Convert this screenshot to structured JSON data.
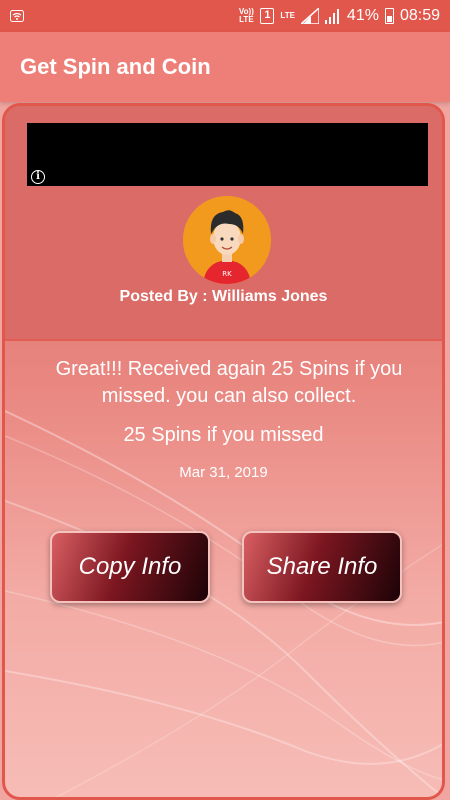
{
  "status_bar": {
    "wifi_icon": "wifi-icon",
    "volte_label": "Vo)) LTE",
    "sim_label": "1",
    "lte_label": "LTE",
    "battery_percent": "41%",
    "time": "08:59"
  },
  "app_bar": {
    "title": "Get Spin and Coin"
  },
  "ad": {
    "info_icon": "info-icon"
  },
  "post": {
    "avatar_initials": "RK",
    "posted_by": "Posted By : Williams Jones",
    "message": "Great!!! Received again 25 Spins if you missed. you can also collect.",
    "spins_line": "25 Spins if you missed",
    "date": "Mar 31, 2019"
  },
  "buttons": {
    "copy_label": "Copy Info",
    "share_label": "Share Info"
  },
  "colors": {
    "status_bar": "#e2574c",
    "app_bar": "#ee7f78",
    "card_border": "#e2574c",
    "avatar_bg": "#f29a1e"
  }
}
